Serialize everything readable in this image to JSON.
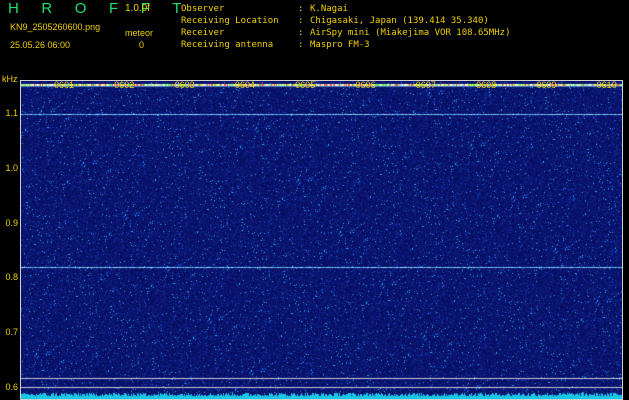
{
  "header": {
    "title": "H R O F F T",
    "mode": "1.0.0f",
    "filename": "KN9_2505260600.png",
    "meteor_label": "meteor",
    "datetime": "25.05.26 06:00",
    "meteor_count": "0"
  },
  "info": [
    {
      "label": "Observer",
      "sep": ":",
      "value": "K.Nagai"
    },
    {
      "label": "Receiving Location",
      "sep": ":",
      "value": "Chigasaki, Japan (139.414 35.340)"
    },
    {
      "label": "Receiver",
      "sep": ":",
      "value": "AirSpy mini (Miakejima VOR 108.65MHz)"
    },
    {
      "label": "Receiving antenna",
      "sep": ":",
      "value": "Maspro FM-3"
    }
  ],
  "axes": {
    "unit": "kHz",
    "x_ticks": [
      "0601",
      "0602",
      "0603",
      "0604",
      "0605",
      "0606",
      "0607",
      "0608",
      "0609",
      "0610"
    ],
    "y_ticks": [
      "1.1",
      "1.0",
      "0.9",
      "0.8",
      "0.7",
      "0.6"
    ],
    "y_range": [
      0.58,
      1.16
    ]
  },
  "colors": {
    "background": "#000000",
    "text": "#f0d000",
    "title": "#1fe06a",
    "waterfall_base": "#0a1470",
    "bottom_noise": "#19c8e8"
  },
  "waterfall": {
    "carrier_lines_khz": [
      1.153,
      1.098,
      0.819
    ],
    "reference_lines_khz": [
      0.617,
      0.6
    ]
  }
}
